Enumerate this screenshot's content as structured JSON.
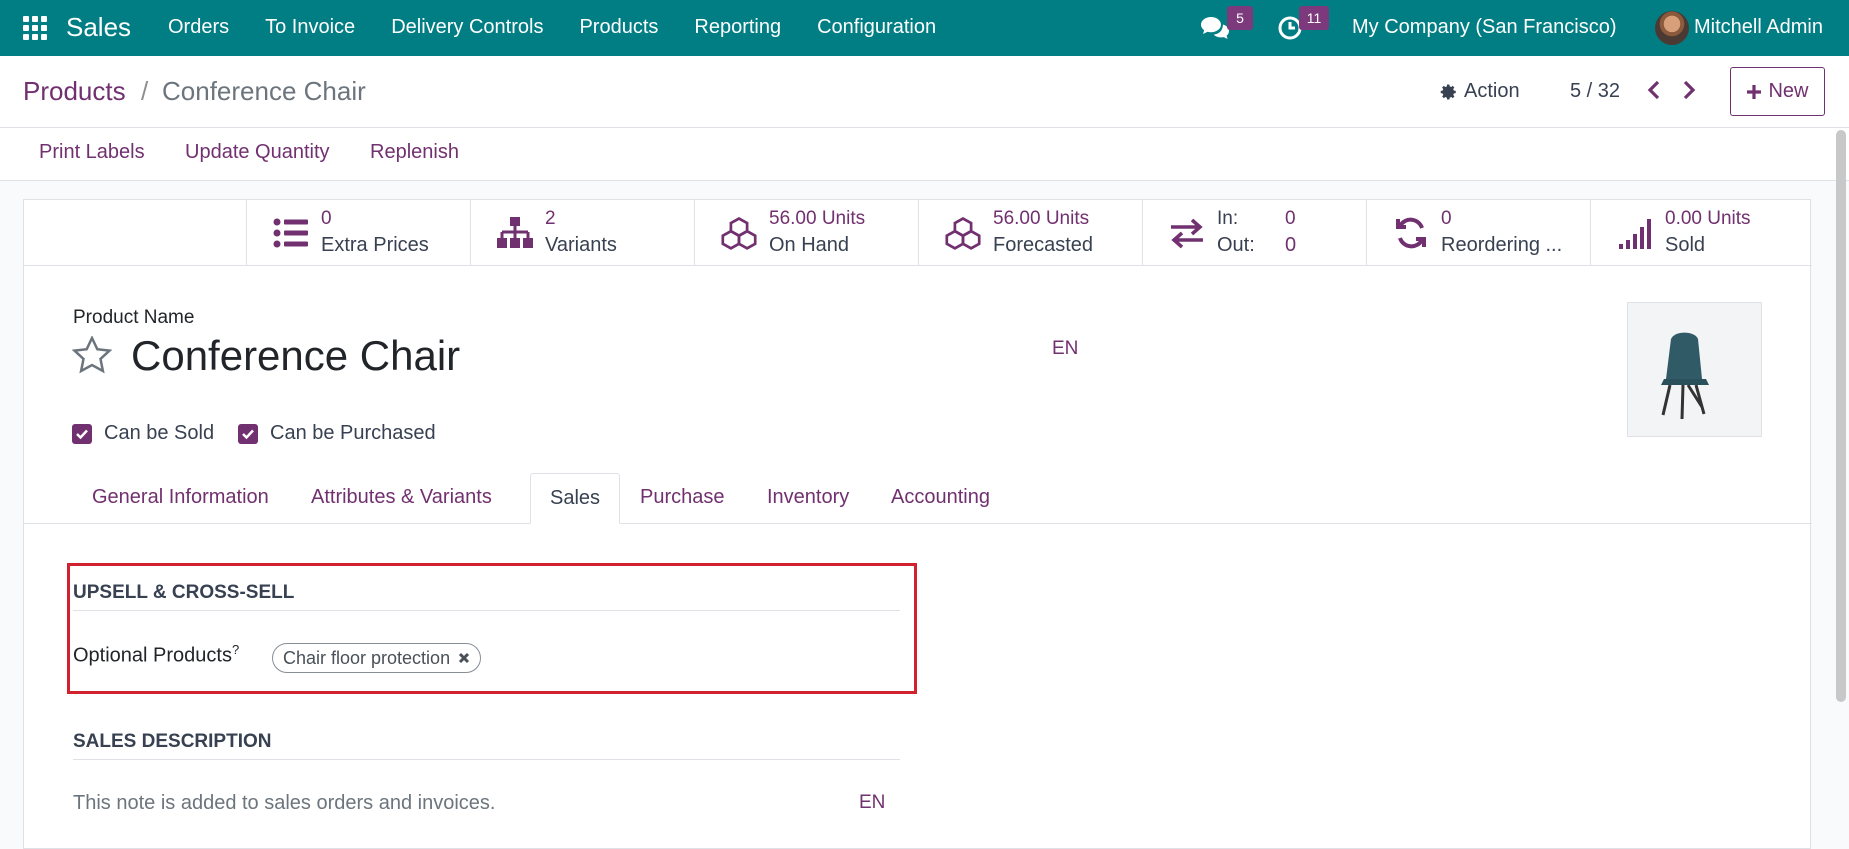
{
  "navbar": {
    "brand": "Sales",
    "menu": [
      "Orders",
      "To Invoice",
      "Delivery Controls",
      "Products",
      "Reporting",
      "Configuration"
    ],
    "messages_count": "5",
    "activities_count": "11",
    "company": "My Company (San Francisco)",
    "user": "Mitchell Admin"
  },
  "control": {
    "breadcrumb_root": "Products",
    "breadcrumb_sep": "/",
    "breadcrumb_current": "Conference Chair",
    "action_label": "Action",
    "pager": "5 / 32",
    "new_label": "New"
  },
  "statusbar": {
    "buttons": [
      "Print Labels",
      "Update Quantity",
      "Replenish"
    ]
  },
  "stats": [
    {
      "value": "0",
      "label": "Extra Prices",
      "icon": "list-icon"
    },
    {
      "value": "2",
      "label": "Variants",
      "icon": "sitemap-icon"
    },
    {
      "value": "56.00 Units",
      "label": "On Hand",
      "icon": "cubes-icon"
    },
    {
      "value": "56.00 Units",
      "label": "Forecasted",
      "icon": "cubes-icon"
    },
    {
      "in_label": "In:",
      "in_value": "0",
      "out_label": "Out:",
      "out_value": "0",
      "icon": "exchange-icon"
    },
    {
      "value": "0",
      "label": "Reordering ...",
      "icon": "refresh-icon"
    },
    {
      "value": "0.00 Units",
      "label": "Sold",
      "icon": "signal-icon"
    }
  ],
  "form": {
    "product_name_label": "Product Name",
    "product_name": "Conference Chair",
    "lang": "EN",
    "can_be_sold": "Can be Sold",
    "can_be_purchased": "Can be Purchased"
  },
  "tabs": [
    "General Information",
    "Attributes & Variants",
    "Sales",
    "Purchase",
    "Inventory",
    "Accounting"
  ],
  "sales_tab": {
    "upsell_title": "UPSELL & CROSS-SELL",
    "optional_label": "Optional Products",
    "optional_help": "?",
    "optional_tag": "Chair floor protection",
    "sales_desc_title": "SALES DESCRIPTION",
    "sales_desc_placeholder": "This note is added to sales orders and invoices.",
    "desc_lang": "EN"
  },
  "colors": {
    "navbar": "#017e84",
    "accent": "#71306f",
    "highlight": "#d0232f"
  }
}
